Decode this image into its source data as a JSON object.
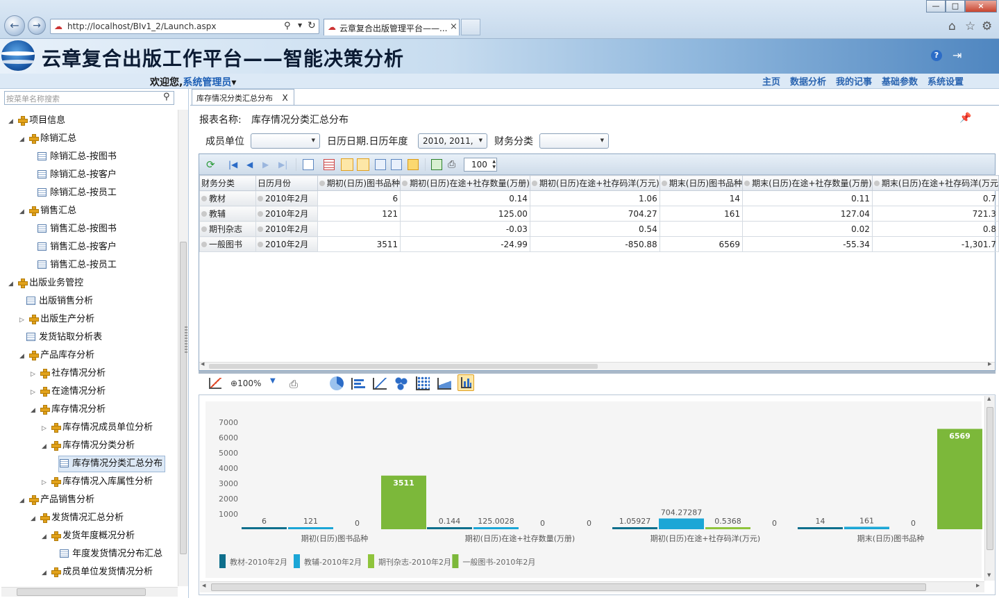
{
  "browser": {
    "url": "http://localhost/BIv1_2/Launch.aspx",
    "tab_title": "云章复合出版管理平台——...",
    "tab_close": "×",
    "win_min": "—",
    "win_max": "□",
    "win_close": "×"
  },
  "header": {
    "title": "云章复合出版工作平台——智能决策分析",
    "welcome": "欢迎您,",
    "user": "系统管理员",
    "user_caret": "▾",
    "menu": [
      "主页",
      "数据分析",
      "我的记事",
      "基础参数",
      "系统设置"
    ]
  },
  "sidebar": {
    "search_placeholder": "按菜单名称搜索",
    "items": [
      {
        "label": "项目信息",
        "level": 0,
        "icon": "folder",
        "expander": "◢"
      },
      {
        "label": "除销汇总",
        "level": 1,
        "icon": "folder",
        "expander": "◢"
      },
      {
        "label": "除销汇总-按图书",
        "level": 2,
        "icon": "doc",
        "expander": ""
      },
      {
        "label": "除销汇总-按客户",
        "level": 2,
        "icon": "doc",
        "expander": ""
      },
      {
        "label": "除销汇总-按员工",
        "level": 2,
        "icon": "doc",
        "expander": ""
      },
      {
        "label": "销售汇总",
        "level": 1,
        "icon": "folder",
        "expander": "◢"
      },
      {
        "label": "销售汇总-按图书",
        "level": 2,
        "icon": "doc",
        "expander": ""
      },
      {
        "label": "销售汇总-按客户",
        "level": 2,
        "icon": "doc",
        "expander": ""
      },
      {
        "label": "销售汇总-按员工",
        "level": 2,
        "icon": "doc",
        "expander": ""
      },
      {
        "label": "出版业务管控",
        "level": 0,
        "icon": "folder",
        "expander": "◢"
      },
      {
        "label": "出版销售分析",
        "level": 1,
        "icon": "doc",
        "expander": ""
      },
      {
        "label": "出版生产分析",
        "level": 1,
        "icon": "folder",
        "expander": "▷"
      },
      {
        "label": "发货钻取分析表",
        "level": 1,
        "icon": "doc",
        "expander": ""
      },
      {
        "label": "产品库存分析",
        "level": 1,
        "icon": "folder",
        "expander": "◢"
      },
      {
        "label": "社存情况分析",
        "level": 2,
        "icon": "folder",
        "expander": "▷"
      },
      {
        "label": "在途情况分析",
        "level": 2,
        "icon": "folder",
        "expander": "▷"
      },
      {
        "label": "库存情况分析",
        "level": 2,
        "icon": "folder",
        "expander": "◢"
      },
      {
        "label": "库存情况成员单位分析",
        "level": 3,
        "icon": "folder",
        "expander": "▷"
      },
      {
        "label": "库存情况分类分析",
        "level": 3,
        "icon": "folder",
        "expander": "◢"
      },
      {
        "label": "库存情况分类汇总分布",
        "level": 4,
        "icon": "doc",
        "expander": ""
      },
      {
        "label": "库存情况入库属性分析",
        "level": 3,
        "icon": "folder",
        "expander": "▷"
      },
      {
        "label": "产品销售分析",
        "level": 1,
        "icon": "folder",
        "expander": "◢"
      },
      {
        "label": "发货情况汇总分析",
        "level": 2,
        "icon": "folder",
        "expander": "◢"
      },
      {
        "label": "发货年度概况分析",
        "level": 3,
        "icon": "folder",
        "expander": "◢"
      },
      {
        "label": "年度发货情况分布汇总",
        "level": 4,
        "icon": "doc",
        "expander": ""
      },
      {
        "label": "成员单位发货情况分析",
        "level": 3,
        "icon": "folder",
        "expander": "◢"
      }
    ]
  },
  "report": {
    "tab_label": "库存情况分类汇总分布",
    "tab_close": "X",
    "name_label": "报表名称:",
    "name_value": "库存情况分类汇总分布",
    "filters": {
      "member_label": "成员单位",
      "member_value": "",
      "date_label": "日历日期.日历年度",
      "date_value": "2010, 2011,",
      "category_label": "财务分类",
      "category_value": ""
    },
    "page_size": "100",
    "zoom": "100%"
  },
  "table": {
    "columns": [
      "财务分类",
      "日历月份",
      "期初(日历)图书品种",
      "期初(日历)在途+社存数量(万册)",
      "期初(日历)在途+社存码洋(万元)",
      "期末(日历)图书品种",
      "期末(日历)在途+社存数量(万册)",
      "期末(日历)在途+社存码洋(万元"
    ],
    "rows": [
      [
        "教材",
        "2010年2月",
        "6",
        "0.14",
        "1.06",
        "14",
        "0.11",
        "0.7"
      ],
      [
        "教辅",
        "2010年2月",
        "121",
        "125.00",
        "704.27",
        "161",
        "127.04",
        "721.3"
      ],
      [
        "期刊杂志",
        "2010年2月",
        "",
        "-0.03",
        "0.54",
        "",
        "0.02",
        "0.8"
      ],
      [
        "一般图书",
        "2010年2月",
        "3511",
        "-24.99",
        "-850.88",
        "6569",
        "-55.34",
        "-1,301.7"
      ]
    ]
  },
  "chart_data": {
    "type": "bar",
    "categories": [
      "期初(日历)图书品种",
      "期初(日历)在途+社存数量(万册)",
      "期初(日历)在途+社存码洋(万元)",
      "期末(日历)图书品种"
    ],
    "series": [
      {
        "name": "教材-2010年2月",
        "color": "#0e6f8c",
        "values": [
          6,
          0.144,
          1.05927,
          14
        ],
        "labels": [
          "6",
          "0.144",
          "1.05927",
          "14"
        ]
      },
      {
        "name": "教辅-2010年2月",
        "color": "#1ba6d6",
        "values": [
          121,
          125.0028,
          704.27287,
          161
        ],
        "labels": [
          "121",
          "125.0028",
          "704.27287",
          "161"
        ]
      },
      {
        "name": "期刊杂志-2010年2月",
        "color": "#8fc43c",
        "values": [
          0,
          0,
          0.5368,
          0
        ],
        "labels": [
          "0",
          "0",
          "0.5368",
          "0"
        ]
      },
      {
        "name": "一般图书-2010年2月",
        "color": "#7cb83a",
        "values": [
          3511,
          0,
          0,
          6569
        ],
        "labels": [
          "3511",
          "0",
          "0",
          "6569"
        ]
      }
    ],
    "yticks": [
      "1000",
      "2000",
      "3000",
      "4000",
      "5000",
      "6000",
      "7000"
    ],
    "ylim": [
      0,
      7000
    ],
    "legend": "bottom-left"
  }
}
